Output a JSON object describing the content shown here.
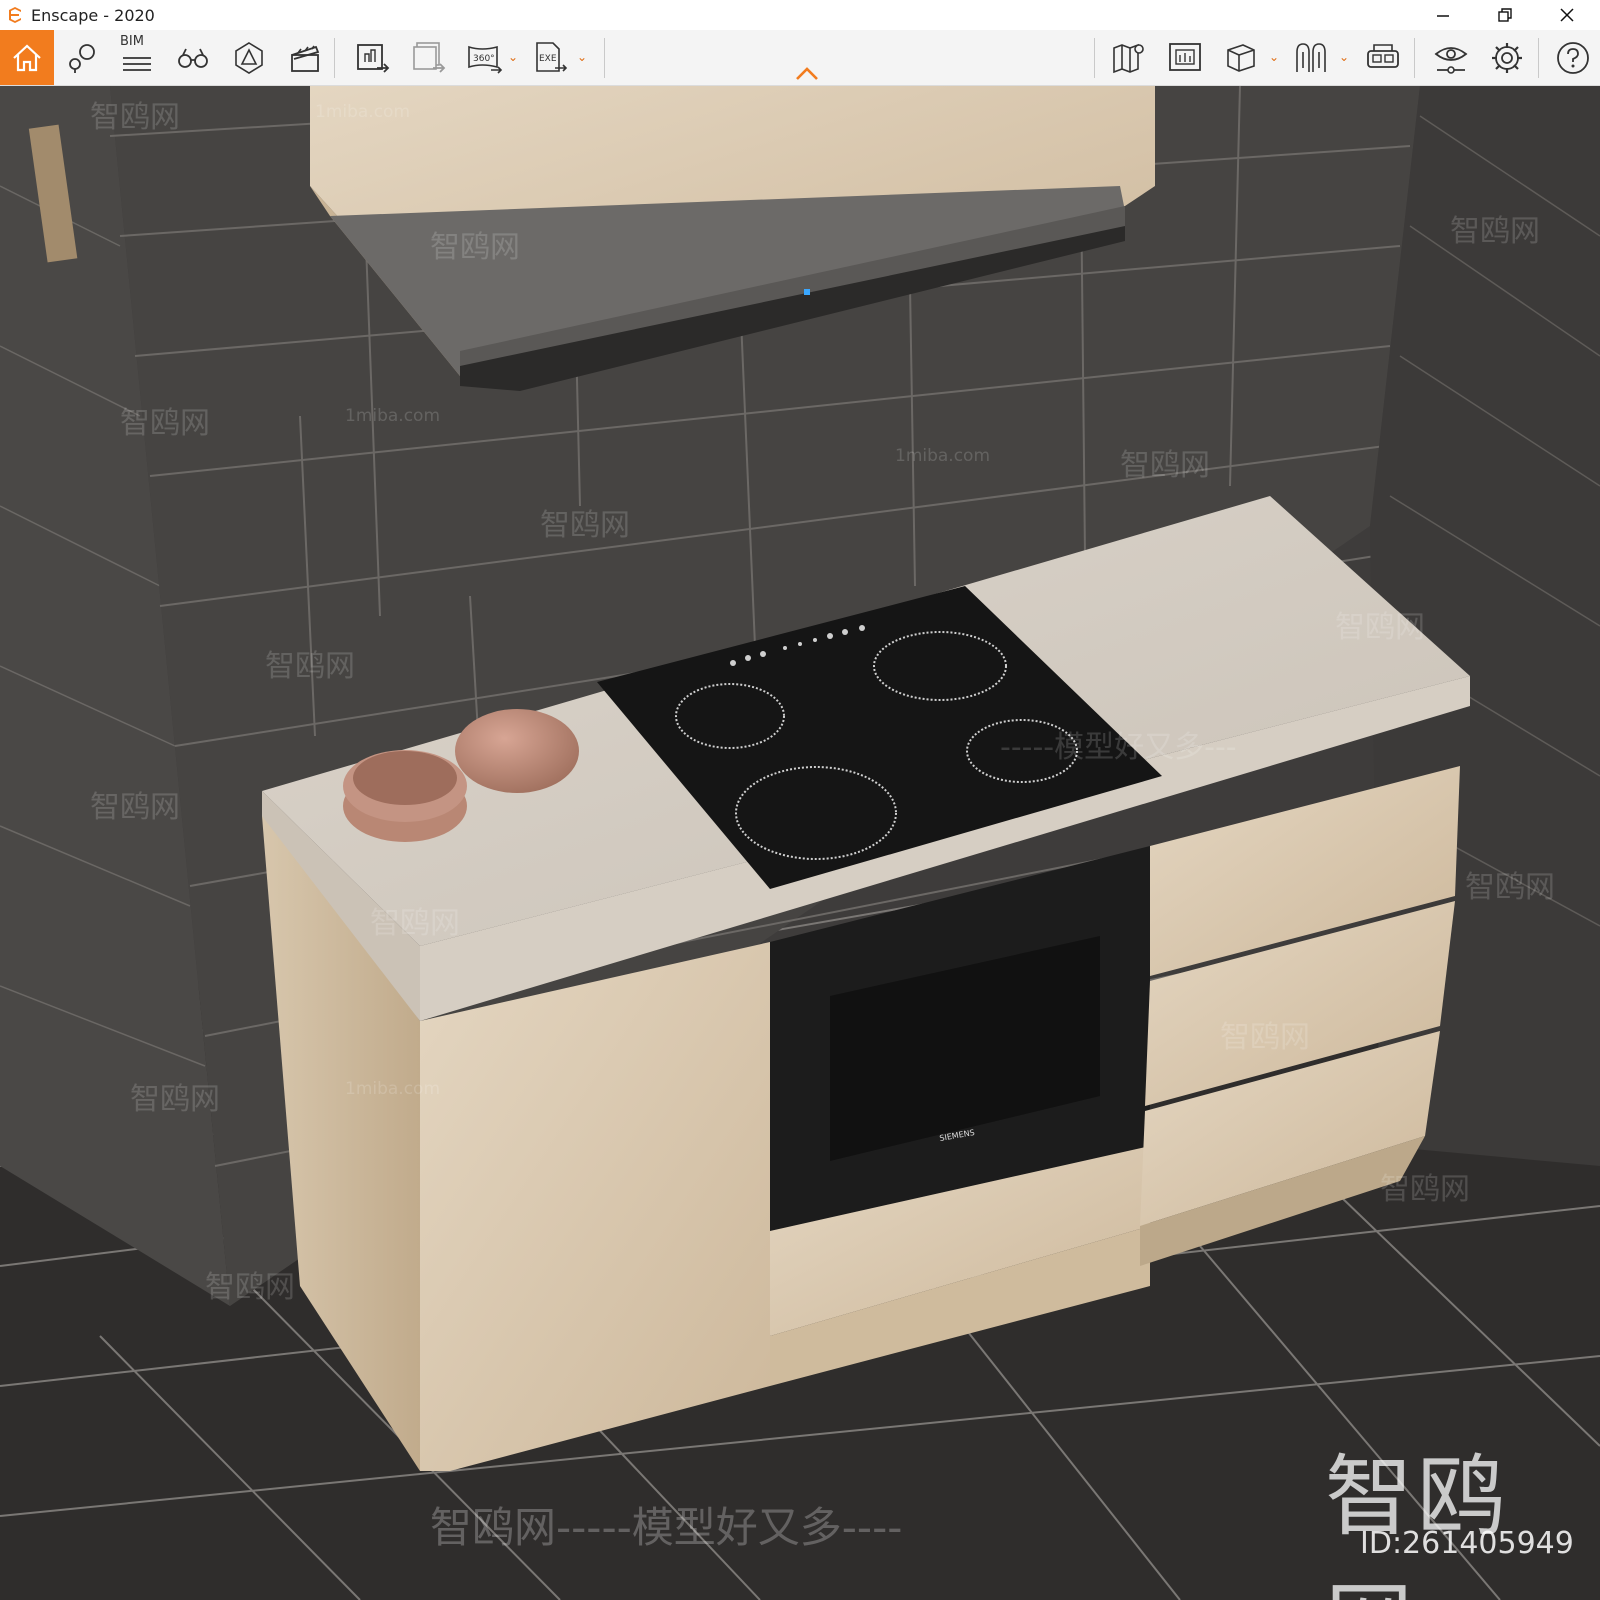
{
  "window": {
    "title": "Enscape - 2020",
    "controls": {
      "minimize": "—",
      "restore": "❐",
      "close": "✕"
    }
  },
  "toolbar": {
    "accent_color": "#f27c1e",
    "bim_label": "BIM",
    "tools_360_label": "360°",
    "exe_label": "EXE",
    "icons": [
      "home-icon",
      "location-pin-icon",
      "bim-icon",
      "binoculars-icon",
      "safe-frame-icon",
      "clapperboard-icon",
      "screenshot-export-icon",
      "batch-render-icon",
      "panorama-360-icon",
      "exe-export-icon",
      "map-icon",
      "object-library-icon",
      "material-box-icon",
      "atmosphere-icon",
      "vr-headset-icon",
      "visual-settings-icon",
      "settings-gear-icon",
      "help-icon"
    ]
  },
  "watermarks": {
    "site": "1miba.com",
    "brand": "智鸥网",
    "slogan": "智鸥网-----模型好又多----",
    "slogan_right": "-----模型好又多---",
    "id_label": "ID:261405949"
  },
  "oven": {
    "brand_text": "SIEMENS"
  }
}
